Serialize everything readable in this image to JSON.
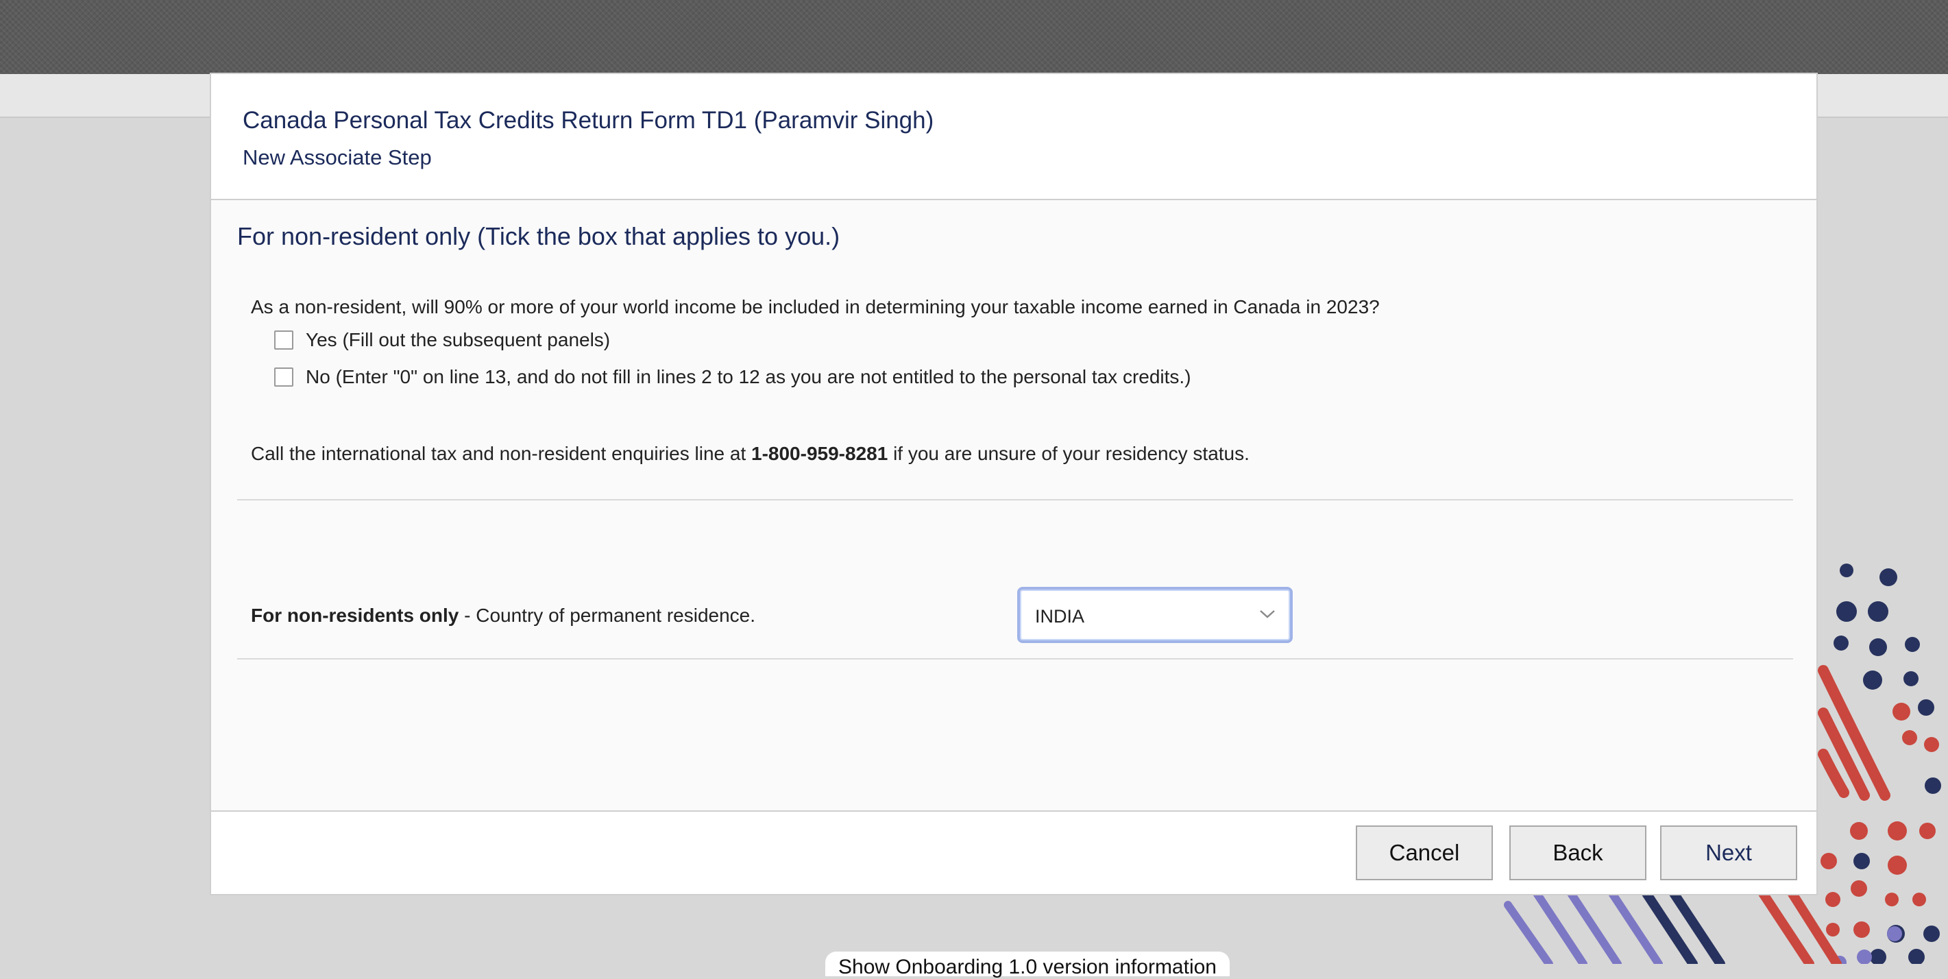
{
  "modal": {
    "title": "Canada Personal Tax Credits Return Form TD1 (Paramvir Singh)",
    "subtitle": "New Associate Step"
  },
  "section": {
    "heading": "For non-resident only (Tick the box that applies to you.)",
    "question": "As a non-resident, will 90% or more of your world income be included in determining your taxable income earned in Canada in 2023?",
    "options": [
      {
        "label": "Yes (Fill out the subsequent panels)",
        "checked": false
      },
      {
        "label": "No (Enter \"0\" on line 13, and do not fill in lines 2 to 12 as you are not entitled to the personal tax credits.)",
        "checked": false
      }
    ],
    "call_prefix": "Call the international tax and non-resident enquiries line at ",
    "call_phone": "1-800-959-8281",
    "call_suffix": " if you are unsure of your residency status."
  },
  "country": {
    "label_bold": "For non-residents only",
    "label_rest": " - Country of permanent residence.",
    "selected": "INDIA"
  },
  "buttons": {
    "cancel": "Cancel",
    "back": "Back",
    "next": "Next"
  },
  "footer_link": "Show Onboarding 1.0 version information",
  "colors": {
    "title_navy": "#1b2a5a",
    "focus_ring": "#9fb3e8",
    "decor_red": "#c9473e",
    "decor_navy": "#27325e",
    "decor_violet": "#7d78c4"
  }
}
